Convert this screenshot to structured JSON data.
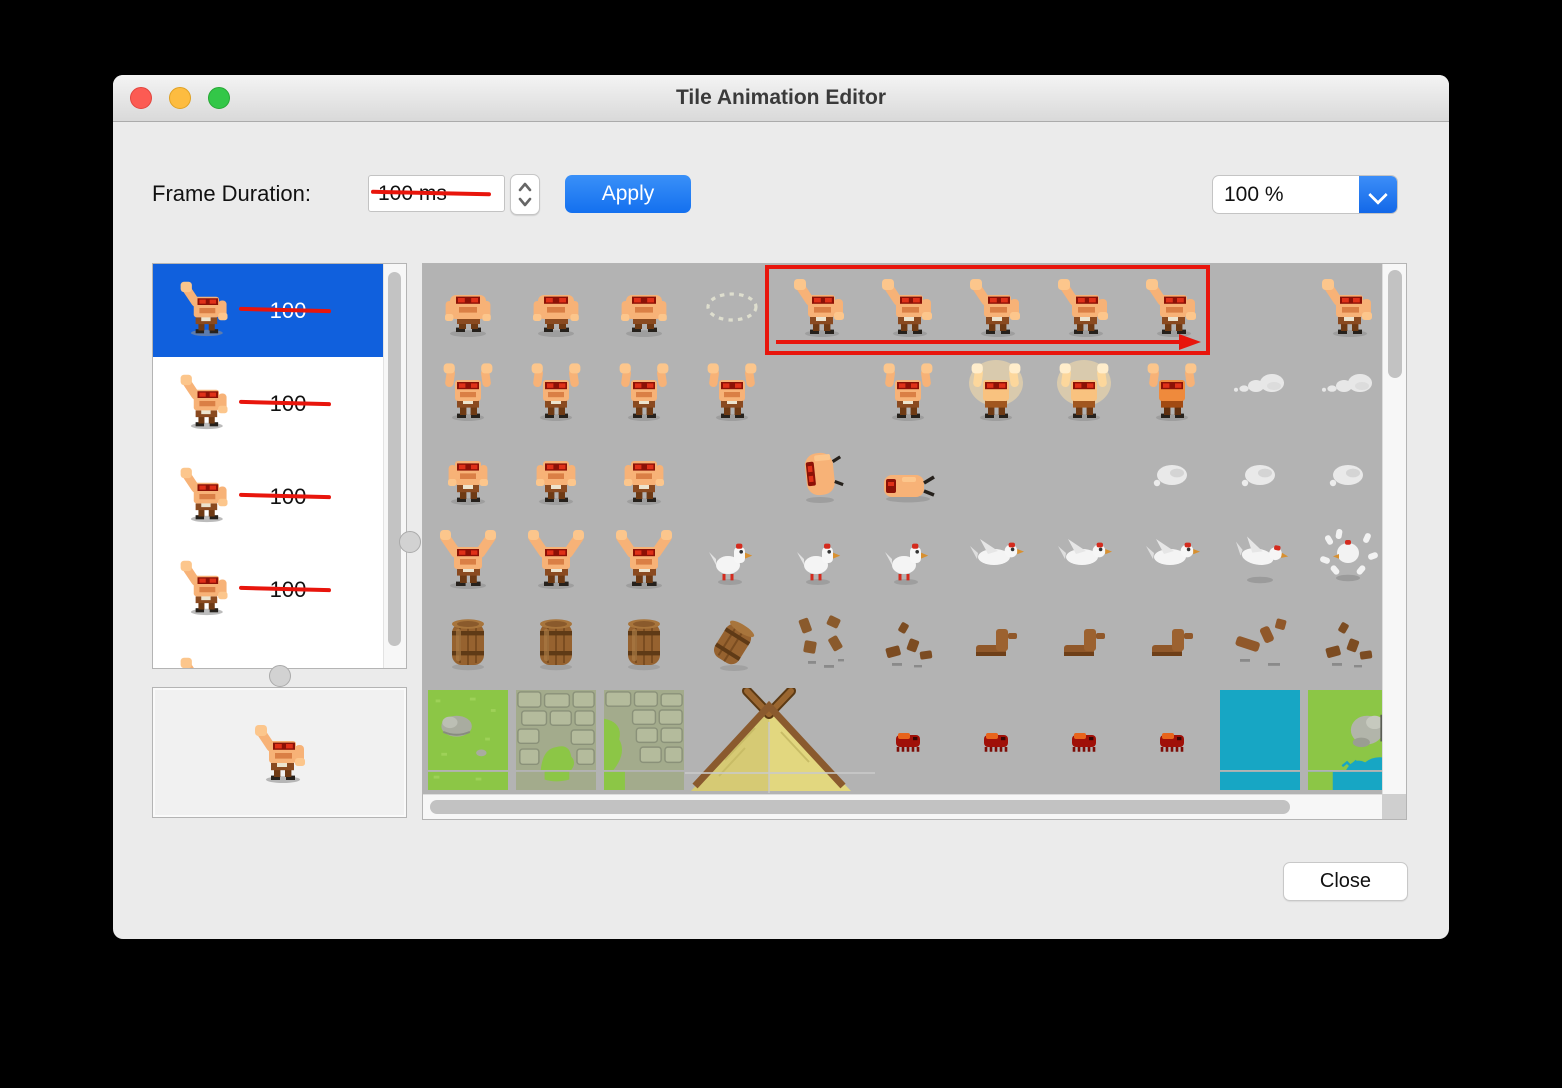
{
  "window": {
    "title": "Tile Animation Editor"
  },
  "toolbar": {
    "frame_duration_label": "Frame Duration:",
    "frame_duration_value": "100 ms",
    "apply_label": "Apply",
    "zoom_value": "100 %"
  },
  "frame_list": {
    "items": [
      {
        "duration": "100",
        "selected": true
      },
      {
        "duration": "100",
        "selected": false
      },
      {
        "duration": "100",
        "selected": false
      },
      {
        "duration": "100",
        "selected": false
      },
      {
        "duration": "",
        "selected": false
      }
    ]
  },
  "footer": {
    "close_label": "Close"
  },
  "colors": {
    "selection_blue": "#1060dd",
    "accent_blue": "#1b7ef2",
    "annotation_red": "#e8150c",
    "tileset_background": "#b3b3b3"
  },
  "tileset": {
    "cells": [
      {
        "t": "crouch",
        "c": 0,
        "r": 0
      },
      {
        "t": "crouch",
        "c": 1,
        "r": 0
      },
      {
        "t": "crouch",
        "c": 2,
        "r": 0
      },
      {
        "t": "marquee",
        "c": 3,
        "r": 0
      },
      {
        "t": "raised",
        "c": 4,
        "r": 0
      },
      {
        "t": "raised",
        "c": 5,
        "r": 0
      },
      {
        "t": "raised",
        "c": 6,
        "r": 0
      },
      {
        "t": "raised",
        "c": 7,
        "r": 0
      },
      {
        "t": "raised",
        "c": 8,
        "r": 0
      },
      {
        "t": "raised",
        "c": 10,
        "r": 0
      },
      {
        "t": "armsup",
        "c": 0,
        "r": 1
      },
      {
        "t": "armsup",
        "c": 1,
        "r": 1
      },
      {
        "t": "armsup",
        "c": 2,
        "r": 1
      },
      {
        "t": "armsup",
        "c": 3,
        "r": 1
      },
      {
        "t": "armsup",
        "c": 5,
        "r": 1
      },
      {
        "t": "glow",
        "c": 6,
        "r": 1
      },
      {
        "t": "glow",
        "c": 7,
        "r": 1
      },
      {
        "t": "armsup2",
        "c": 8,
        "r": 1
      },
      {
        "t": "smokedash",
        "c": 9,
        "r": 1
      },
      {
        "t": "smokedash",
        "c": 10,
        "r": 1
      },
      {
        "t": "stand",
        "c": 0,
        "r": 2
      },
      {
        "t": "stand",
        "c": 1,
        "r": 2
      },
      {
        "t": "stand",
        "c": 2,
        "r": 2
      },
      {
        "t": "roll",
        "c": 4,
        "r": 2
      },
      {
        "t": "fallen",
        "c": 5,
        "r": 2
      },
      {
        "t": "puff",
        "c": 8,
        "r": 2
      },
      {
        "t": "puff",
        "c": 9,
        "r": 2
      },
      {
        "t": "puff",
        "c": 10,
        "r": 2
      },
      {
        "t": "armsv",
        "c": 0,
        "r": 3
      },
      {
        "t": "armsv",
        "c": 1,
        "r": 3
      },
      {
        "t": "armsv",
        "c": 2,
        "r": 3
      },
      {
        "t": "chicken",
        "c": 3,
        "r": 3
      },
      {
        "t": "chicken",
        "c": 4,
        "r": 3
      },
      {
        "t": "chicken",
        "c": 5,
        "r": 3
      },
      {
        "t": "chickfly",
        "c": 6,
        "r": 3
      },
      {
        "t": "chickfly",
        "c": 7,
        "r": 3
      },
      {
        "t": "chickfly",
        "c": 8,
        "r": 3
      },
      {
        "t": "chickland",
        "c": 9,
        "r": 3
      },
      {
        "t": "chickburst",
        "c": 10,
        "r": 3
      },
      {
        "t": "barrel",
        "c": 0,
        "r": 4
      },
      {
        "t": "barrel",
        "c": 1,
        "r": 4
      },
      {
        "t": "barrel",
        "c": 2,
        "r": 4
      },
      {
        "t": "barreltilt",
        "c": 3,
        "r": 4
      },
      {
        "t": "debris",
        "c": 4,
        "r": 4
      },
      {
        "t": "debris2",
        "c": 5,
        "r": 4
      },
      {
        "t": "stump",
        "c": 6,
        "r": 4
      },
      {
        "t": "stump",
        "c": 7,
        "r": 4
      },
      {
        "t": "stump",
        "c": 8,
        "r": 4
      },
      {
        "t": "stumpbroken",
        "c": 9,
        "r": 4
      },
      {
        "t": "debris2",
        "c": 10,
        "r": 4
      },
      {
        "t": "grass",
        "c": 0,
        "r": 5
      },
      {
        "t": "stoneA",
        "c": 1,
        "r": 5
      },
      {
        "t": "stoneB",
        "c": 2,
        "r": 5
      },
      {
        "t": "tent",
        "c": 3,
        "r": 5
      },
      {
        "t": "crab",
        "c": 5,
        "r": 5
      },
      {
        "t": "crab",
        "c": 6,
        "r": 5
      },
      {
        "t": "crab",
        "c": 7,
        "r": 5
      },
      {
        "t": "crab",
        "c": 8,
        "r": 5
      },
      {
        "t": "water",
        "c": 9,
        "r": 5
      },
      {
        "t": "grasswater",
        "c": 10,
        "r": 5
      }
    ]
  }
}
